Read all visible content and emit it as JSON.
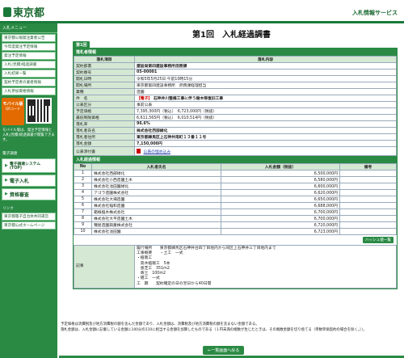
{
  "header": {
    "logo_text": "東京都",
    "service_name": "入札情報サービス"
  },
  "sidebar": {
    "menu_title": "入札メニュー",
    "links": [
      "東京都公報発注業者公告",
      "今年度発注予定情報",
      "発注予定情報",
      "入札(見積)経過調書",
      "入札結果一覧",
      "契約予定者の業者情報",
      "入札参加資格情報"
    ],
    "mobile_button": "モバイル版",
    "mobile_button_sub": "QRコード",
    "mobile_note": "モバイル版は、発注予定情報と入札(見積)経過調書が閲覧できます。",
    "system_title": "電子調達",
    "big_links": [
      "電子調達システム(TOP)",
      "電子入札",
      "資格審査"
    ],
    "links_title": "リンク",
    "bottom_links": [
      "東京都電子自治体共同運営",
      "東京都公式ホームページ"
    ]
  },
  "page": {
    "title": "第1回　入札経過調書",
    "round_tab": "第1回"
  },
  "case_info": {
    "section_title": "落札者情報",
    "col_item": "落札項目",
    "col_content": "落札内容",
    "rows": [
      {
        "label": "契約部署",
        "value": "建設局第四建設事務所庶務課"
      },
      {
        "label": "契約番号",
        "value": "05-00001"
      },
      {
        "label": "開札日時",
        "value": "令和5年5月25日 午前10時15分"
      },
      {
        "label": "開札場所",
        "value": "東京都第四建設事務所　庶務課経理担当"
      },
      {
        "label": "業種",
        "value": "造園"
      },
      {
        "label": "件　名",
        "value": "石神井川整備工事に伴う樹木等復旧工事",
        "tag": "【電子】"
      },
      {
        "label": "公表区分",
        "value": "事前公表"
      },
      {
        "label": "予定価格",
        "value": "7,395,300円（税込）　6,723,000円（税抜）"
      },
      {
        "label": "最低制限価格",
        "value": "6,611,565円（税込）　6,010,514円（税抜）"
      },
      {
        "label": "落札率",
        "value": "96.6%"
      },
      {
        "label": "落札者氏名",
        "value": "株式会社西部緑化"
      },
      {
        "label": "落札者住所",
        "value": "東京都練馬区上石神井南町１３番１１号"
      },
      {
        "label": "落札金額",
        "value": "7,150,000円"
      }
    ],
    "docs_label": "公表添付書",
    "docs_link": "公表の埋め込み"
  },
  "bid_info": {
    "section_title": "入札経過情報",
    "col_no": "No",
    "col_name": "入札者氏名",
    "col_amount": "入札金額（税抜）",
    "col_note": "備考",
    "rows": [
      {
        "no": "1",
        "name": "株式会社西部緑化",
        "amount": "6,500,000円",
        "note": ""
      },
      {
        "no": "2",
        "name": "株式会社小西造園土木",
        "amount": "6,580,000円",
        "note": ""
      },
      {
        "no": "3",
        "name": "株式会社池田園緑化",
        "amount": "6,600,000円",
        "note": ""
      },
      {
        "no": "4",
        "name": "アゴラ造園株式会社",
        "amount": "6,620,000円",
        "note": ""
      },
      {
        "no": "5",
        "name": "株式会社大場造園",
        "amount": "6,650,000円",
        "note": ""
      },
      {
        "no": "6",
        "name": "株式会社稲和造園",
        "amount": "6,688,000円",
        "note": ""
      },
      {
        "no": "7",
        "name": "箱根植木株式会社",
        "amount": "6,700,000円",
        "note": ""
      },
      {
        "no": "8",
        "name": "株式会社大平造園土木",
        "amount": "6,700,000円",
        "note": ""
      },
      {
        "no": "9",
        "name": "種屋造園興業株式会社",
        "amount": "6,720,000円",
        "note": ""
      },
      {
        "no": "10",
        "name": "株式会社池田園",
        "amount": "6,723,000円",
        "note": ""
      }
    ],
    "hash_button": "ハッシュ値一覧"
  },
  "remarks": {
    "label": "記事",
    "text": "履行場所　　東京都練馬区石神井台四丁目地内から同区上石神井三丁目地内まで\n工事概要　　・土工　一式\n・植栽工\n　高木植栽工　5本\n　張芝工　351m2\n　寄土　100m2\n・雑工　一式\n工　期　　契約確定の日の翌日から40日間"
  },
  "footnote": "予定価格は消費税及び地方消費税の額を含んだ金額であり、入札金額は、消費税及び地方消費税の額を含まない金額である。\n落札金額は、入札金額に記載している金額に100分の110に相当する金額を加算したものである（１円未満の端数が生じたときは、その端数金額を切り捨てる（単数単価契約の場合を除く。））。",
  "back_button": "←一覧画面へ戻る"
}
